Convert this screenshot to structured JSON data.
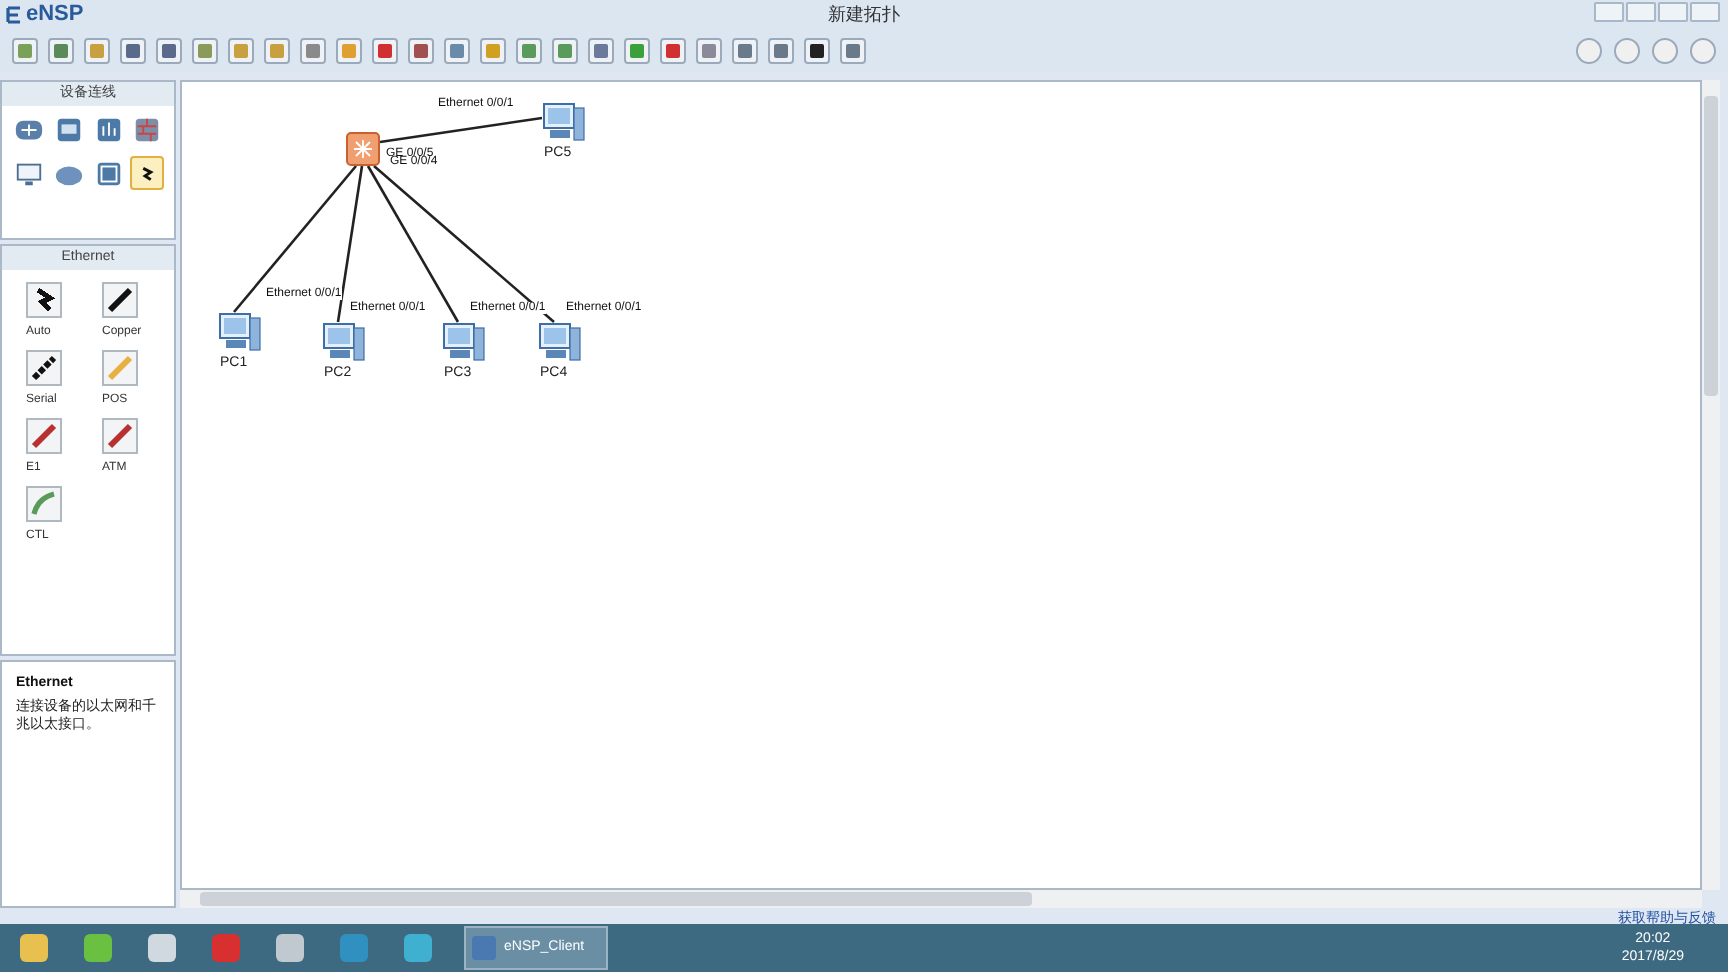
{
  "window": {
    "app_name": "eNSP",
    "title": "新建拓扑"
  },
  "device_panel": {
    "title": "设备连线",
    "devices": [
      {
        "kind": "router",
        "selected": false
      },
      {
        "kind": "switch",
        "selected": false
      },
      {
        "kind": "wireless",
        "selected": false
      },
      {
        "kind": "firewall",
        "selected": false
      },
      {
        "kind": "pc",
        "selected": false
      },
      {
        "kind": "cloud",
        "selected": false
      },
      {
        "kind": "other",
        "selected": false
      },
      {
        "kind": "cable",
        "selected": true
      }
    ]
  },
  "cable_panel": {
    "title": "Ethernet",
    "cables": [
      {
        "label": "Auto",
        "color": "#111111"
      },
      {
        "label": "Copper",
        "color": "#111111"
      },
      {
        "label": "Serial",
        "color": "#111111"
      },
      {
        "label": "POS",
        "color": "#e8b040"
      },
      {
        "label": "E1",
        "color": "#b83030"
      },
      {
        "label": "ATM",
        "color": "#b83030"
      },
      {
        "label": "CTL",
        "color": "#5a9a5a"
      }
    ]
  },
  "info_panel": {
    "title": "Ethernet",
    "text": "连接设备的以太网和千兆以太接口。"
  },
  "topology": {
    "nodes": [
      {
        "kind": "switch"
      },
      {
        "kind": "pc",
        "label": "PC5"
      },
      {
        "kind": "pc",
        "label": "PC1"
      },
      {
        "kind": "pc",
        "label": "PC2"
      },
      {
        "kind": "pc",
        "label": "PC3"
      },
      {
        "kind": "pc",
        "label": "PC4"
      }
    ],
    "links": [
      {
        "from_port": "GE 0/0/5",
        "to_port": "Ethernet 0/0/1"
      },
      {
        "to_port": "Ethernet 0/0/1"
      },
      {
        "to_port": "Ethernet 0/0/1"
      },
      {
        "to_port": "Ethernet 0/0/1"
      },
      {
        "from_port": "GE 0/0/4",
        "to_port": "Ethernet 0/0/1"
      }
    ]
  },
  "status_bar": {
    "help_link": "获取帮助与反馈"
  },
  "taskbar": {
    "active_app": "eNSP_Client",
    "time": "20:02",
    "date": "2017/8/29"
  }
}
